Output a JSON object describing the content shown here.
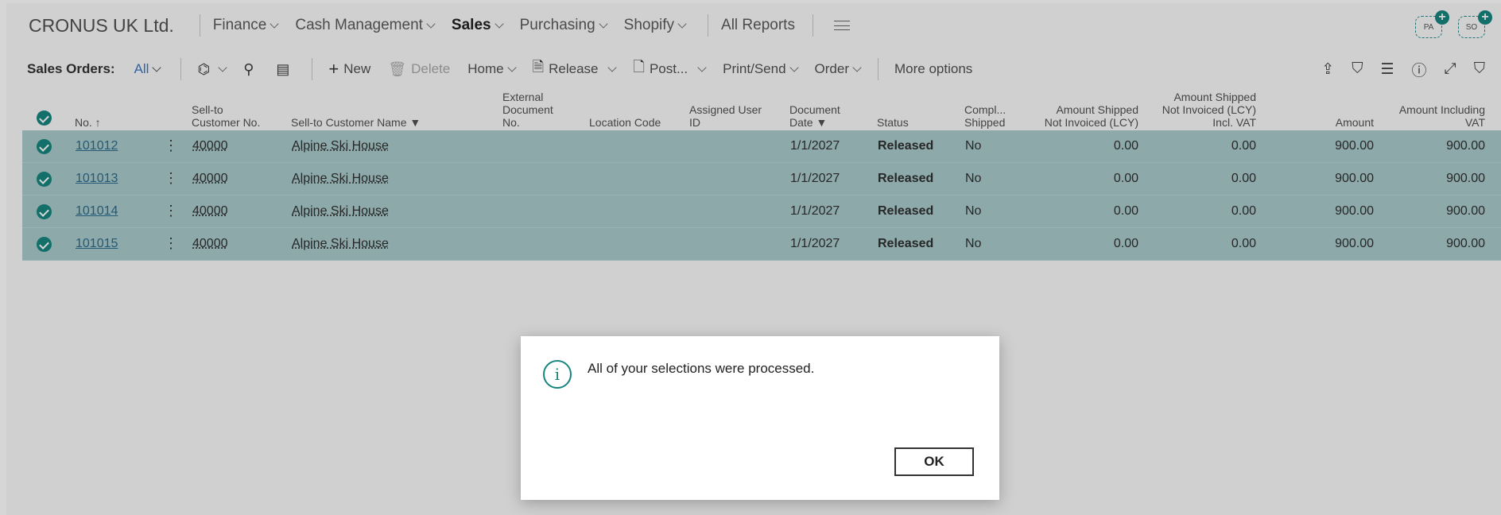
{
  "topnav": {
    "company": "CRONUS UK Ltd.",
    "items": [
      {
        "label": "Finance",
        "dropdown": true,
        "active": false
      },
      {
        "label": "Cash Management",
        "dropdown": true,
        "active": false
      },
      {
        "label": "Sales",
        "dropdown": true,
        "active": true
      },
      {
        "label": "Purchasing",
        "dropdown": true,
        "active": false
      },
      {
        "label": "Shopify",
        "dropdown": true,
        "active": false
      }
    ],
    "all_reports": "All Reports",
    "avatars": [
      "PA",
      "SO"
    ]
  },
  "actionbar": {
    "page_name": "Sales Orders:",
    "view_filter": "All",
    "new_label": "New",
    "delete_label": "Delete",
    "home_label": "Home",
    "release_label": "Release",
    "post_label": "Post...",
    "print_send_label": "Print/Send",
    "order_label": "Order",
    "more_options_label": "More options"
  },
  "grid": {
    "headers": {
      "no": "No. ↑",
      "sell_to_no_1": "Sell-to",
      "sell_to_no_2": "Customer No.",
      "sell_to_name": "Sell-to Customer Name",
      "ext_doc_1": "External",
      "ext_doc_2": "Document",
      "ext_doc_3": "No.",
      "location": "Location Code",
      "assigned_1": "Assigned User",
      "assigned_2": "ID",
      "doc_date_1": "Document",
      "doc_date_2": "Date",
      "status": "Status",
      "compl_1": "Compl...",
      "compl_2": "Shipped",
      "asni_1": "Amount Shipped",
      "asni_2": "Not Invoiced (LCY)",
      "asnivat_1": "Amount Shipped",
      "asnivat_2": "Not Invoiced (LCY)",
      "asnivat_3": "Incl. VAT",
      "amount": "Amount",
      "amount_vat_1": "Amount Including",
      "amount_vat_2": "VAT"
    },
    "rows": [
      {
        "no": "101012",
        "cust_no": "40000",
        "cust_name": "Alpine Ski House",
        "doc_date": "1/1/2027",
        "status": "Released",
        "shipped": "No",
        "asni": "0.00",
        "asni_vat": "0.00",
        "amount": "900.00",
        "amount_vat": "900.00"
      },
      {
        "no": "101013",
        "cust_no": "40000",
        "cust_name": "Alpine Ski House",
        "doc_date": "1/1/2027",
        "status": "Released",
        "shipped": "No",
        "asni": "0.00",
        "asni_vat": "0.00",
        "amount": "900.00",
        "amount_vat": "900.00"
      },
      {
        "no": "101014",
        "cust_no": "40000",
        "cust_name": "Alpine Ski House",
        "doc_date": "1/1/2027",
        "status": "Released",
        "shipped": "No",
        "asni": "0.00",
        "asni_vat": "0.00",
        "amount": "900.00",
        "amount_vat": "900.00"
      },
      {
        "no": "101015",
        "cust_no": "40000",
        "cust_name": "Alpine Ski House",
        "doc_date": "1/1/2027",
        "status": "Released",
        "shipped": "No",
        "asni": "0.00",
        "asni_vat": "0.00",
        "amount": "900.00",
        "amount_vat": "900.00"
      }
    ]
  },
  "dialog": {
    "message": "All of your selections were processed.",
    "ok_label": "OK"
  },
  "colors": {
    "accent": "#17857f",
    "selected_row": "#a8cacb",
    "link": "#2d6a8c"
  }
}
